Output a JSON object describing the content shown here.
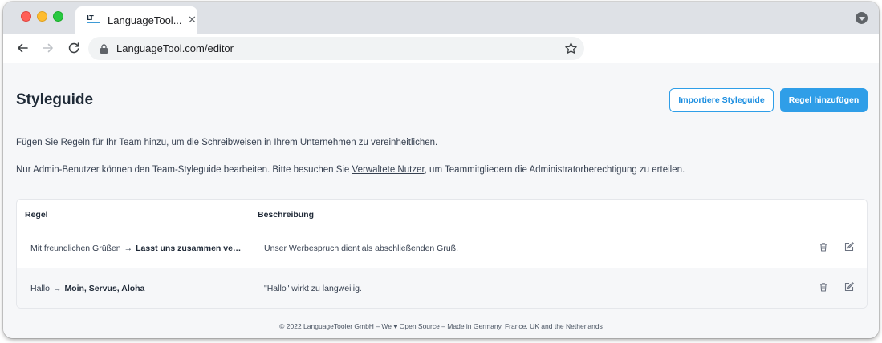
{
  "browser": {
    "tab": {
      "favicon_text": "LT",
      "title": "LanguageTool...",
      "close_symbol": "✕"
    },
    "address": {
      "url": "LanguageTool.com/editor"
    }
  },
  "page": {
    "title": "Styleguide",
    "import_button": "Importiere Styleguide",
    "add_rule_button": "Regel hinzufügen",
    "intro": "Fügen Sie Regeln für Ihr Team hinzu, um die Schreibweisen in Ihrem Unternehmen zu vereinheitlichen.",
    "notice": {
      "before": "Nur Admin-Benutzer können den Team-Styleguide bearbeiten. Bitte besuchen Sie ",
      "link": "Verwaltete Nutzer",
      "after": ", um Teammitgliedern die Administratorberechtigung zu erteilen."
    }
  },
  "table": {
    "headers": {
      "rule": "Regel",
      "description": "Beschreibung"
    },
    "rows": [
      {
        "original": "Mit freundlichen Grüßen",
        "arrow": "→",
        "replacement": "Lasst uns zusammen ve…",
        "description": "Unser Werbespruch dient als abschließenden Gruß."
      },
      {
        "original": "Hallo",
        "arrow": "→",
        "replacement": "Moin, Servus, Aloha",
        "description": "\"Hallo\" wirkt zu langweilig."
      }
    ]
  },
  "footer": {
    "text": "© 2022 LanguageTooler GmbH – We ♥ Open Source – Made in Germany, France, UK and the Netherlands"
  },
  "colors": {
    "accent": "#2f9ee8",
    "page_background": "#f6f7f9"
  }
}
